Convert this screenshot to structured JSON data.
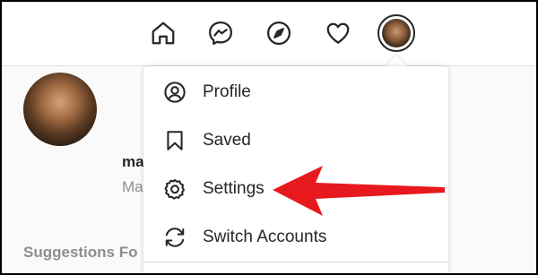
{
  "nav": {
    "icons": [
      "home-icon",
      "messenger-icon",
      "explore-icon",
      "activity-heart-icon",
      "profile-avatar-icon"
    ]
  },
  "profile": {
    "name": "ma",
    "subtitle": "Ma"
  },
  "suggestions_label": "Suggestions Fo",
  "menu": {
    "items": [
      {
        "label": "Profile",
        "icon": "profile-circle-icon"
      },
      {
        "label": "Saved",
        "icon": "bookmark-icon"
      },
      {
        "label": "Settings",
        "icon": "gear-icon"
      },
      {
        "label": "Switch Accounts",
        "icon": "switch-accounts-icon"
      }
    ]
  },
  "colors": {
    "annotation_arrow": "#e8191e",
    "icon_stroke": "#262626",
    "muted_text": "#8e8e8e"
  }
}
